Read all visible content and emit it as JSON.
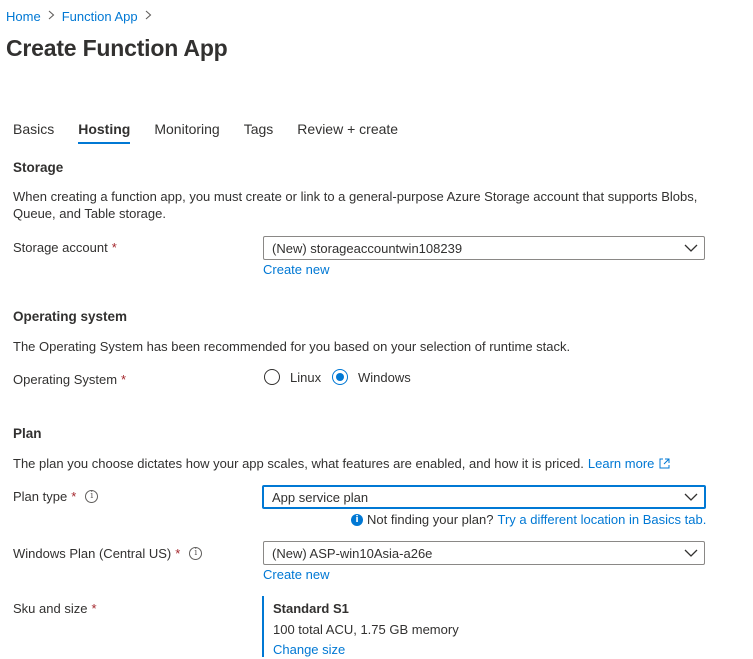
{
  "breadcrumb": {
    "items": [
      "Home",
      "Function App"
    ]
  },
  "page_title": "Create Function App",
  "tabs": [
    {
      "label": "Basics",
      "active": false
    },
    {
      "label": "Hosting",
      "active": true
    },
    {
      "label": "Monitoring",
      "active": false
    },
    {
      "label": "Tags",
      "active": false
    },
    {
      "label": "Review + create",
      "active": false
    }
  ],
  "storage": {
    "title": "Storage",
    "description": "When creating a function app, you must create or link to a general-purpose Azure Storage account that supports Blobs, Queue, and Table storage.",
    "account_label": "Storage account",
    "account_value": "(New) storageaccountwin108239",
    "create_new": "Create new"
  },
  "os": {
    "title": "Operating system",
    "description": "The Operating System has been recommended for you based on your selection of runtime stack.",
    "label": "Operating System",
    "options": [
      {
        "label": "Linux",
        "checked": false
      },
      {
        "label": "Windows",
        "checked": true
      }
    ]
  },
  "plan": {
    "title": "Plan",
    "description": "The plan you choose dictates how your app scales, what features are enabled, and how it is priced.",
    "learn_more": "Learn more",
    "type_label": "Plan type",
    "type_value": "App service plan",
    "not_finding": "Not finding your plan?",
    "try_location": "Try a different location in Basics tab.",
    "windows_plan_label": "Windows Plan (Central US)",
    "windows_plan_value": "(New) ASP-win10Asia-a26e",
    "create_new": "Create new",
    "sku_label": "Sku and size",
    "sku_title": "Standard S1",
    "sku_desc": "100 total ACU, 1.75 GB memory",
    "change_size": "Change size"
  },
  "required_marker": "*",
  "colors": {
    "accent": "#0078d4",
    "required": "#a4262c",
    "text": "#323130"
  }
}
